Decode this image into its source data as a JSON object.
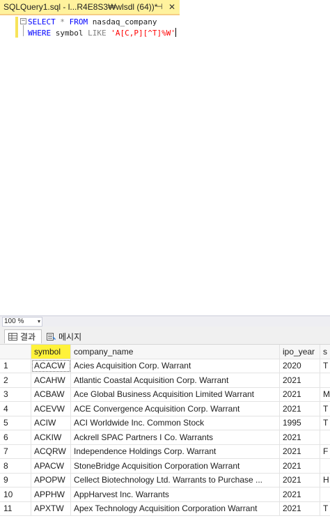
{
  "tab": {
    "title": "SQLQuery1.sql - l...R4E8S3₩wlsdl (64))*",
    "pin_glyph": "⊣",
    "close_glyph": "✕"
  },
  "editor": {
    "fold_glyph": "−",
    "line1": {
      "kw1": "SELECT",
      "star": " * ",
      "kw2": "FROM",
      "table": " nasdaq_company"
    },
    "line2": {
      "kw1": "WHERE",
      "col": " symbol ",
      "kw2": "LIKE",
      "space": " ",
      "pattern": "'A[C,P][^T]%W'"
    }
  },
  "zoom": {
    "value": "100 %",
    "arrow": "▾"
  },
  "results_tabs": [
    {
      "label": "결과",
      "icon": "grid-icon",
      "active": true
    },
    {
      "label": "메시지",
      "icon": "message-icon",
      "active": false
    }
  ],
  "grid": {
    "columns": [
      "symbol",
      "company_name",
      "ipo_year",
      "s"
    ],
    "rows": [
      {
        "n": "1",
        "symbol": "ACACW",
        "company": "Acies Acquisition Corp. Warrant",
        "ipo": "2020",
        "extra": "T"
      },
      {
        "n": "2",
        "symbol": "ACAHW",
        "company": "Atlantic Coastal Acquisition Corp. Warrant",
        "ipo": "2021",
        "extra": ""
      },
      {
        "n": "3",
        "symbol": "ACBAW",
        "company": "Ace Global Business Acquisition Limited Warrant",
        "ipo": "2021",
        "extra": "M"
      },
      {
        "n": "4",
        "symbol": "ACEVW",
        "company": "ACE Convergence Acquisition Corp. Warrant",
        "ipo": "2021",
        "extra": "T"
      },
      {
        "n": "5",
        "symbol": "ACIW",
        "company": "ACI Worldwide Inc. Common Stock",
        "ipo": "1995",
        "extra": "T"
      },
      {
        "n": "6",
        "symbol": "ACKIW",
        "company": "Ackrell SPAC Partners I Co. Warrants",
        "ipo": "2021",
        "extra": ""
      },
      {
        "n": "7",
        "symbol": "ACQRW",
        "company": "Independence Holdings Corp. Warrant",
        "ipo": "2021",
        "extra": "F"
      },
      {
        "n": "8",
        "symbol": "APACW",
        "company": "StoneBridge Acquisition Corporation Warrant",
        "ipo": "2021",
        "extra": ""
      },
      {
        "n": "9",
        "symbol": "APOPW",
        "company": "Cellect Biotechnology Ltd. Warrants to Purchase ...",
        "ipo": "2021",
        "extra": "H"
      },
      {
        "n": "10",
        "symbol": "APPHW",
        "company": "AppHarvest Inc. Warrants",
        "ipo": "2021",
        "extra": ""
      },
      {
        "n": "11",
        "symbol": "APXTW",
        "company": "Apex Technology Acquisition Corporation Warrant",
        "ipo": "2021",
        "extra": "T"
      }
    ]
  },
  "colors": {
    "tab_active": "#fff29d",
    "header_highlight": "#fff23a",
    "keyword": "#0000ff",
    "string": "#ff0000"
  }
}
